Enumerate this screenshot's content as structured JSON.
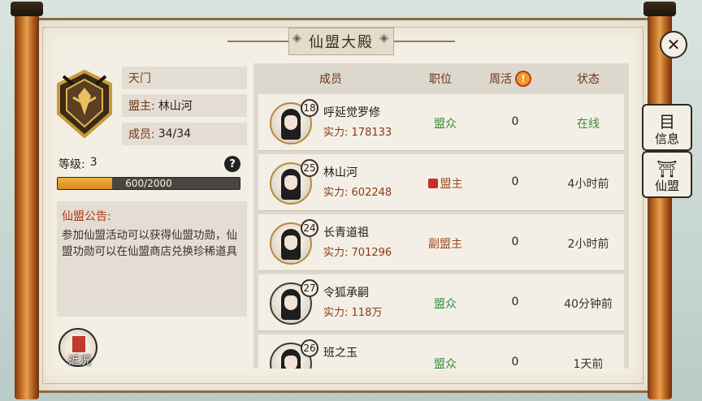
{
  "title": "仙盟大殿",
  "guild": {
    "name": "天门",
    "leader_label": "盟主:",
    "leader_value": "林山河",
    "members_label": "成员:",
    "members_value": "34/34",
    "level_label": "等级:",
    "level_value": "3",
    "exp_text": "600/2000",
    "exp_fraction": 0.3
  },
  "notice": {
    "title": "仙盟公告:",
    "body": "参加仙盟活动可以获得仙盟功勋，仙盟功勋可以在仙盟商店兑换珍稀道具"
  },
  "recent_button": "近况",
  "table": {
    "headers": {
      "member": "成员",
      "position": "职位",
      "weekly": "周活",
      "status": "状态"
    },
    "power_label": "实力:",
    "rows": [
      {
        "level": "18",
        "name": "呼延觉罗修",
        "power": "178133",
        "position": "盟众",
        "weekly": "0",
        "status": "在线"
      },
      {
        "level": "25",
        "name": "林山河",
        "power": "602248",
        "position": "盟主",
        "weekly": "0",
        "status": "4小时前"
      },
      {
        "level": "24",
        "name": "长青道祖",
        "power": "701296",
        "position": "副盟主",
        "weekly": "0",
        "status": "2小时前"
      },
      {
        "level": "27",
        "name": "令狐承嗣",
        "power": "118万",
        "position": "盟众",
        "weekly": "0",
        "status": "40分钟前"
      },
      {
        "level": "26",
        "name": "班之玉",
        "power": "",
        "position": "盟众",
        "weekly": "0",
        "status": "1天前"
      }
    ]
  },
  "side_tabs": {
    "info": "信息",
    "guild": "仙盟"
  },
  "colors": {
    "accent_green": "#3a8a3a",
    "accent_brown": "#a04a18",
    "exp_fill": "#e09a28"
  }
}
